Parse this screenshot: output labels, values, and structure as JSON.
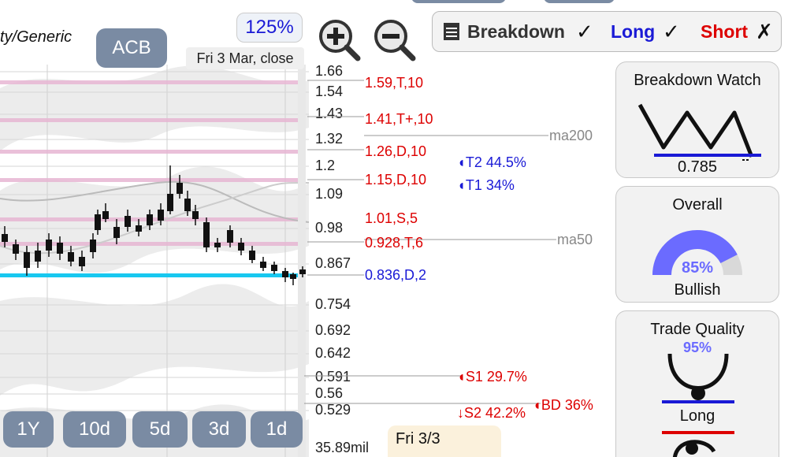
{
  "header": {
    "ticker_partial": "ty/Generic",
    "symbol": "ACB",
    "zoom": "125%",
    "date_label": "Fri 3 Mar, close",
    "zoom_in_icon": "zoom-in-icon",
    "zoom_out_icon": "zoom-out-icon"
  },
  "toolbar": {
    "breakdown_label": "Breakdown",
    "breakdown_mark": "✓",
    "long_label": "Long",
    "long_mark": "✓",
    "short_label": "Short",
    "short_mark": "✗"
  },
  "price_axis": [
    "1.66",
    "1.54",
    "1.43",
    "1.32",
    "1.2",
    "1.09",
    "0.98",
    "0.867",
    "0.754",
    "0.692",
    "0.642",
    "0.591",
    "0.56",
    "0.529",
    "35.89mil"
  ],
  "levels": [
    {
      "text": "1.59,T,10",
      "color": "#d00"
    },
    {
      "text": "1.41,T+,10",
      "color": "#d00"
    },
    {
      "text": "1.26,D,10",
      "color": "#d00"
    },
    {
      "text": "1.15,D,10",
      "color": "#d00"
    },
    {
      "text": "1.01,S,5",
      "color": "#d00"
    },
    {
      "text": "0.928,T,6",
      "color": "#d00"
    },
    {
      "text": "0.836,D,2",
      "color": "#1a1ad6"
    }
  ],
  "ma_labels": {
    "ma200": "ma200",
    "ma50": "ma50"
  },
  "targets": {
    "t2": "T2 44.5%",
    "t1": "T1 34%",
    "s1": "S1 29.7%",
    "s2": "S2 42.2%",
    "bd": "BD 36%"
  },
  "tabs": [
    "1Y",
    "10d",
    "5d",
    "3d",
    "1d"
  ],
  "tooltip": {
    "date": "Fri 3/3"
  },
  "panels": {
    "breakdown_watch": {
      "title": "Breakdown Watch",
      "value": "0.785"
    },
    "overall": {
      "title": "Overall",
      "percent": "85%",
      "label": "Bullish",
      "gauge_fraction": 0.85
    },
    "trade_quality": {
      "title": "Trade Quality",
      "percent": "95%",
      "label": "Long"
    }
  },
  "colors": {
    "accent_blue": "#1a1ad6",
    "red": "#d00",
    "pill": "#7a8ba3",
    "support_line": "#18c8f0",
    "band": "#e7b6d3",
    "gauge": "#6b6bff"
  }
}
